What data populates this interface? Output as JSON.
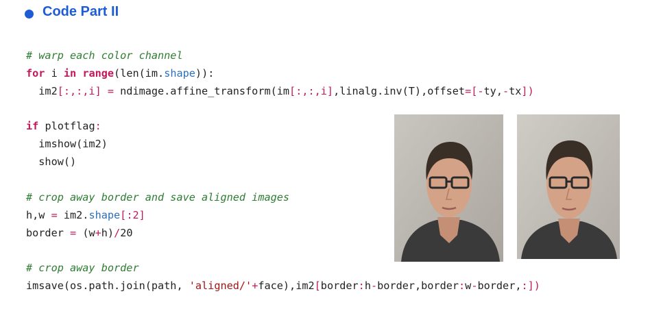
{
  "heading": "Code Part II",
  "code": {
    "line1": "# warp each color channel",
    "line2": {
      "kw1": "for",
      "v": " i ",
      "kw2": "in",
      "sp": " ",
      "kw3": "range",
      "a": "(len(im.",
      "attr": "shape",
      "b": ")):"
    },
    "line3": {
      "a": "  im2",
      "b": "[:,:,i] = ",
      "c": "ndimage.affine_transform(im",
      "d": "[:,:,i]",
      "e": ",linalg.inv(T),offset",
      "f": "=[-",
      "g": "ty,",
      "h": "-",
      "i": "tx",
      "j": "])"
    },
    "line4": {
      "kw": "if",
      "a": " plotflag",
      "b": ":"
    },
    "line5": "  imshow(im2)",
    "line6": "  show()",
    "line7": "# crop away border and save aligned images",
    "line8": {
      "a": "h,w ",
      "b": "=",
      "c": " im2.",
      "attr": "shape",
      "d": "[:2]"
    },
    "line9": {
      "a": "border ",
      "b": "=",
      "c": " (w",
      "d": "+",
      "e": "h)",
      "f": "/",
      "g": "20"
    },
    "line10": "# crop away border",
    "line11": {
      "a": "imsave(os.path.join(path, ",
      "str": "'aligned/'",
      "b": "+",
      "c": "face),im2",
      "d": "[",
      "e": "border",
      "f": ":",
      "g": "h",
      "h": "-",
      "i": "border,border",
      "j": ":",
      "k": "w",
      "l": "-",
      "m": "border,",
      "n": ":])"
    }
  },
  "images": [
    "aligned-face-photo-1",
    "aligned-face-photo-2"
  ]
}
